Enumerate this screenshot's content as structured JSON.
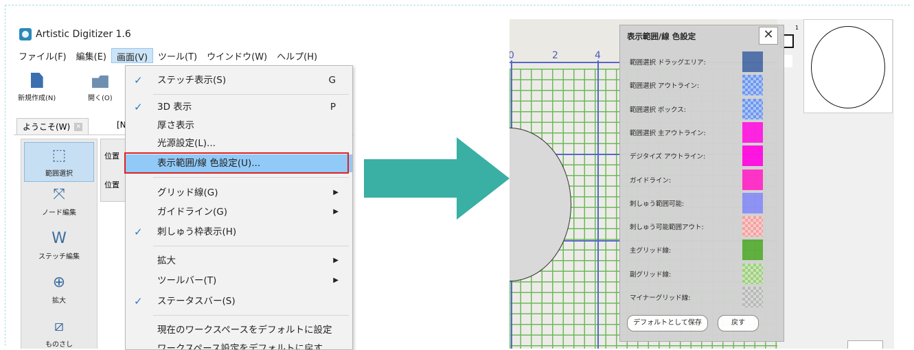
{
  "left": {
    "app_title": "Artistic Digitizer 1.6",
    "menubar": [
      "ファイル(F)",
      "編集(E)",
      "画面(V)",
      "ツール(T)",
      "ウインドウ(W)",
      "ヘルプ(H)"
    ],
    "toolbar": {
      "new": "新規作成(N)",
      "open": "開く(O)"
    },
    "tabs": {
      "welcome": "ようこそ(W)",
      "doc": "[N"
    },
    "panel": {
      "pos1": "位置",
      "pos2": "位置"
    },
    "sidebar": [
      "範囲選択",
      "ノード編集",
      "ステッチ編集",
      "拡大",
      "ものさし"
    ],
    "menu": {
      "stitch": "ステッチ表示(S)",
      "stitch_key": "G",
      "view3d": "3D 表示",
      "view3d_key": "P",
      "thickness": "厚さ表示",
      "light": "光源設定(L)...",
      "range_color": "表示範囲/線 色設定(U)...",
      "grid": "グリッド線(G)",
      "guide": "ガイドライン(G)",
      "hoop": "刺しゅう枠表示(H)",
      "zoom": "拡大",
      "toolbar": "ツールバー(T)",
      "statusbar": "ステータスバー(S)",
      "set_default": "現在のワークスペースをデフォルトに設定",
      "reset_default": "ワークスペース設定をデフォルトに戻す"
    }
  },
  "right": {
    "ruler": [
      "0",
      "2",
      "4"
    ],
    "thumb_number": "1",
    "dialog": {
      "title": "表示範囲/線 色設定",
      "close": "✕",
      "rows": [
        {
          "label": "範囲選択 ドラッグエリア:",
          "color": "#4f6fa8",
          "checker": false
        },
        {
          "label": "範囲選択 アウトライン:",
          "color": "#6a95f0",
          "checker": true
        },
        {
          "label": "範囲選択 ボックス:",
          "color": "#6a95f0",
          "checker": true
        },
        {
          "label": "範囲選択 主アウトライン:",
          "color": "#ff1fe0",
          "checker": false
        },
        {
          "label": "デジタイズ アウトライン:",
          "color": "#ff10e0",
          "checker": false
        },
        {
          "label": "ガイドライン:",
          "color": "#ff2fc8",
          "checker": false
        },
        {
          "label": "刺しゅう範囲可能:",
          "color": "#8a90f5",
          "checker": false
        },
        {
          "label": "刺しゅう可能範囲アウト:",
          "color": "#f5a0a0",
          "checker": true
        },
        {
          "label": "主グリッド線:",
          "color": "#5cae3a",
          "checker": false
        },
        {
          "label": "副グリッド線:",
          "color": "#9fd07e",
          "checker": true
        },
        {
          "label": "マイナーグリッド線:",
          "color": "#b8b8b8",
          "checker": true
        }
      ],
      "save_default": "デフォルトとして保存",
      "back": "戻す"
    }
  },
  "colors": {
    "arrow": "#3aafa3",
    "highlight": "#e0201e",
    "menu_highlight": "#91c9f7"
  }
}
